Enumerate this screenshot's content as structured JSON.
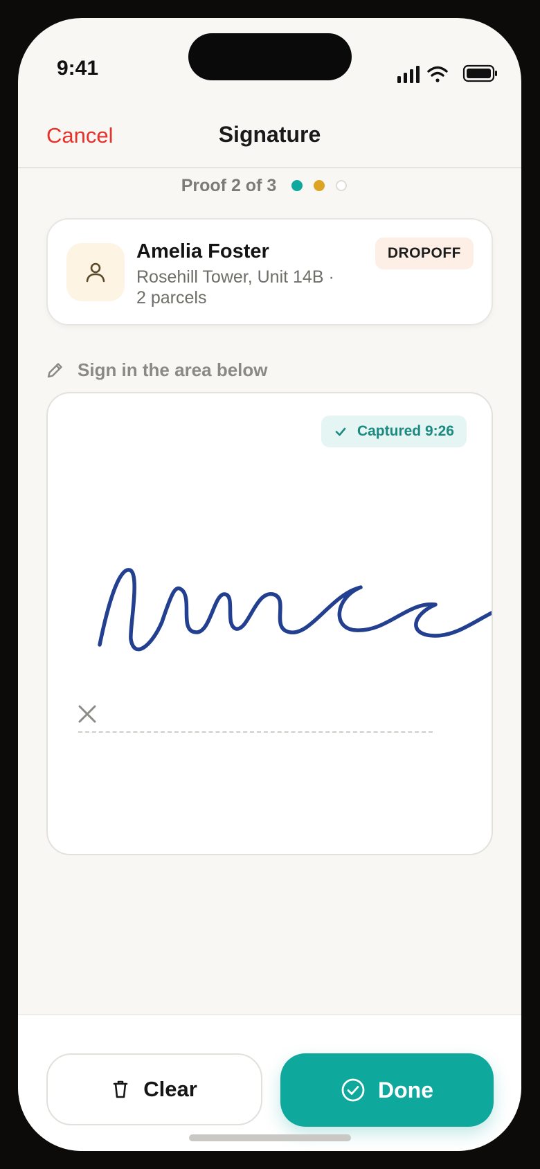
{
  "status_bar": {
    "time": "9:41"
  },
  "nav": {
    "cancel_label": "Cancel",
    "title": "Signature"
  },
  "progress": {
    "label": "Proof 2 of 3",
    "current": 2,
    "total": 3,
    "dot_colors": [
      "#0ea89c",
      "#dca324",
      "#ffffff"
    ]
  },
  "recipient": {
    "name": "Amelia Foster",
    "address_line": "Rosehill Tower, Unit 14B ·",
    "parcels": "2 parcels",
    "badge": "DROPOFF",
    "avatar_icon": "person-icon"
  },
  "signature": {
    "hint": "Sign in the area below",
    "captured_label": "Captured 9:26",
    "ink_color": "#233f8f",
    "mark_icon": "close-icon"
  },
  "actions": {
    "clear_label": "Clear",
    "done_label": "Done",
    "accent": "#0ea89c"
  }
}
